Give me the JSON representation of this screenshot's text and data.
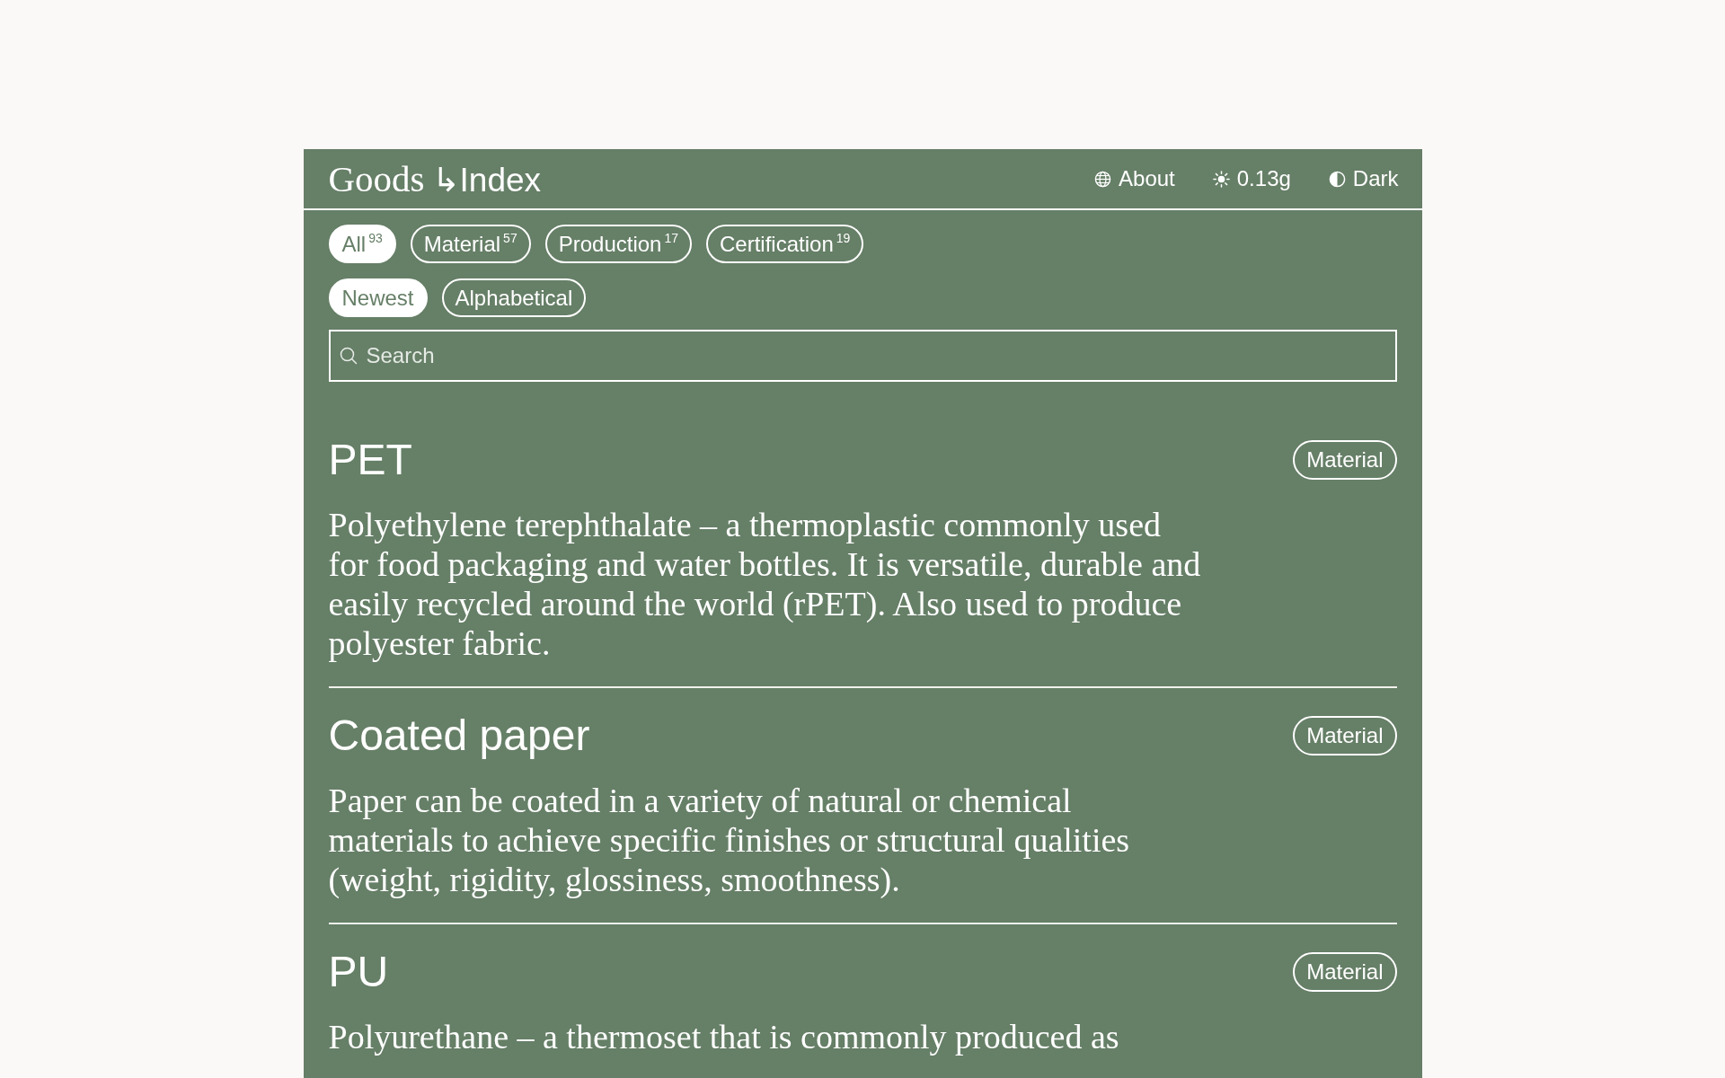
{
  "header": {
    "logo": {
      "primary": "Goods",
      "secondary": "↳Index"
    },
    "nav": [
      {
        "kind": "link",
        "label": "About"
      },
      {
        "kind": "metric",
        "label": "0.13g"
      },
      {
        "kind": "toggle",
        "label": "Dark"
      }
    ]
  },
  "filters": {
    "categories": [
      {
        "label": "All",
        "count": "93",
        "selected": true
      },
      {
        "label": "Material",
        "count": "57",
        "selected": false
      },
      {
        "label": "Production",
        "count": "17",
        "selected": false
      },
      {
        "label": "Certification",
        "count": "19",
        "selected": false
      }
    ],
    "sort": [
      {
        "label": "Newest",
        "selected": true
      },
      {
        "label": "Alphabetical",
        "selected": false
      }
    ]
  },
  "search": {
    "placeholder": "Search"
  },
  "entries": [
    {
      "title": "PET",
      "tag": "Material",
      "description": "Polyethylene terephthalate – a thermoplastic commonly used for food packaging and water bottles. It is versatile, durable and easily recycled around the world (rPET). Also used to produce polyester fabric."
    },
    {
      "title": "Coated paper",
      "tag": "Material",
      "description": "Paper can be coated in a variety of natural or chemical materials to achieve specific finishes or structural qualities (weight, rigidity, glossiness, smoothness)."
    },
    {
      "title": "PU",
      "tag": "Material",
      "description": "Polyurethane – a thermoset that is commonly produced as"
    }
  ]
}
